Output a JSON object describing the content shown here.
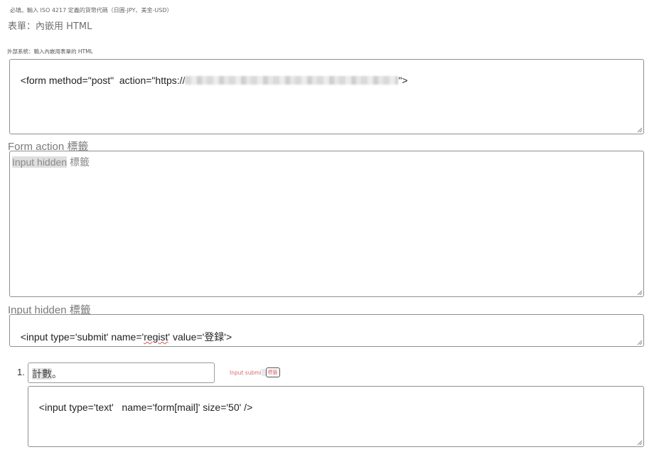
{
  "hints": {
    "currency_hint": "必填。輸入 ISO 4217 定義的貨幣代碼（日圓-JPY、美金-USD）",
    "form_heading": "表單：內嵌用 HTML",
    "external_system_label": "外部系統：輸入內嵌用表單的 HTML"
  },
  "form_html": {
    "prefix": "<form method=\"post\"  action=\"https://",
    "suffix": "\">"
  },
  "form_action": {
    "title": "Form action 標籤",
    "overlay_highlight": "Input hidden",
    "overlay_rest": " 標籤",
    "value": ""
  },
  "input_hidden": {
    "title": "Input hidden 標籤",
    "value_before": "<input type='submit' name='",
    "value_mark": "regist",
    "value_after": "' value='登録'>"
  },
  "items": [
    {
      "number": "1.",
      "input_highlight": "計數",
      "input_rest": "。",
      "mini_label": "Input submi",
      "mini_box": "標籤",
      "html": "<input type='text'   name='form[mail]' size='50' />"
    }
  ]
}
